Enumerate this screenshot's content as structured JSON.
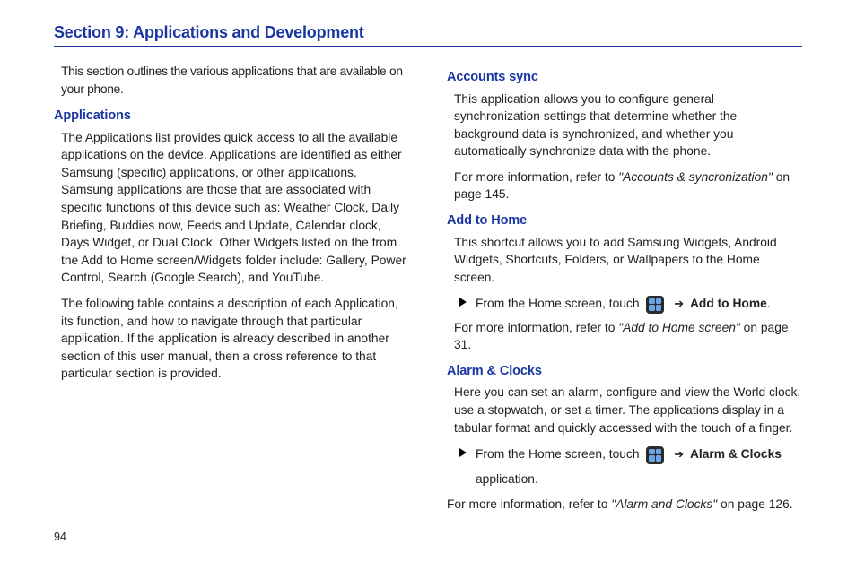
{
  "section_title": "Section 9: Applications and Development",
  "page_number": "94",
  "left": {
    "intro": "This section outlines the various applications that are available on your phone.",
    "h_applications": "Applications",
    "apps_p1": "The Applications list provides quick access to all the available applications on the device. Applications are identified as either Samsung (specific) applications, or other applications. Samsung applications are those that are associated with specific functions of this device such as: Weather Clock, Daily Briefing, Buddies now, Feeds and Update, Calendar clock, Days Widget, or Dual Clock. Other Widgets listed on the from the Add to Home screen/Widgets folder include: Gallery, Power Control, Search (Google Search), and YouTube.",
    "apps_p2": "The following table contains a description of each Application, its function, and how to navigate through that particular application. If the application is already described in another section of this user manual, then a cross reference to that particular section is provided."
  },
  "right": {
    "h_accounts": "Accounts sync",
    "accounts_p1": "This application allows you to configure general synchronization settings that determine whether the background data is synchronized, and whether you automatically synchronize data with the phone.",
    "accounts_ref_pre": "For more information, refer to ",
    "accounts_ref_ital": "\"Accounts & syncronization\"",
    "accounts_ref_post": "  on page 145.",
    "h_addhome": "Add to Home",
    "addhome_p1": "This shortcut allows you to add Samsung Widgets, Android Widgets, Shortcuts, Folders, or Wallpapers to the Home screen.",
    "addhome_bullet_pre": "From the Home screen, touch ",
    "addhome_bullet_post": " Add to Home",
    "addhome_ref_pre": "For more information, refer to ",
    "addhome_ref_ital": "\"Add to Home screen\"",
    "addhome_ref_post": "  on page 31.",
    "h_alarm": "Alarm & Clocks",
    "alarm_p1": "Here you can set an alarm, configure and view the World clock, use a stopwatch, or set a timer. The applications display in a tabular format and quickly accessed with the touch of a finger.",
    "alarm_bullet_pre": "From the Home screen, touch ",
    "alarm_bullet_post": " Alarm  & Clocks",
    "alarm_bullet_line2": "application.",
    "alarm_ref_pre": "For more information, refer to ",
    "alarm_ref_ital": "\"Alarm and Clocks\"",
    "alarm_ref_post": "  on page 126."
  },
  "arrow": "➔"
}
